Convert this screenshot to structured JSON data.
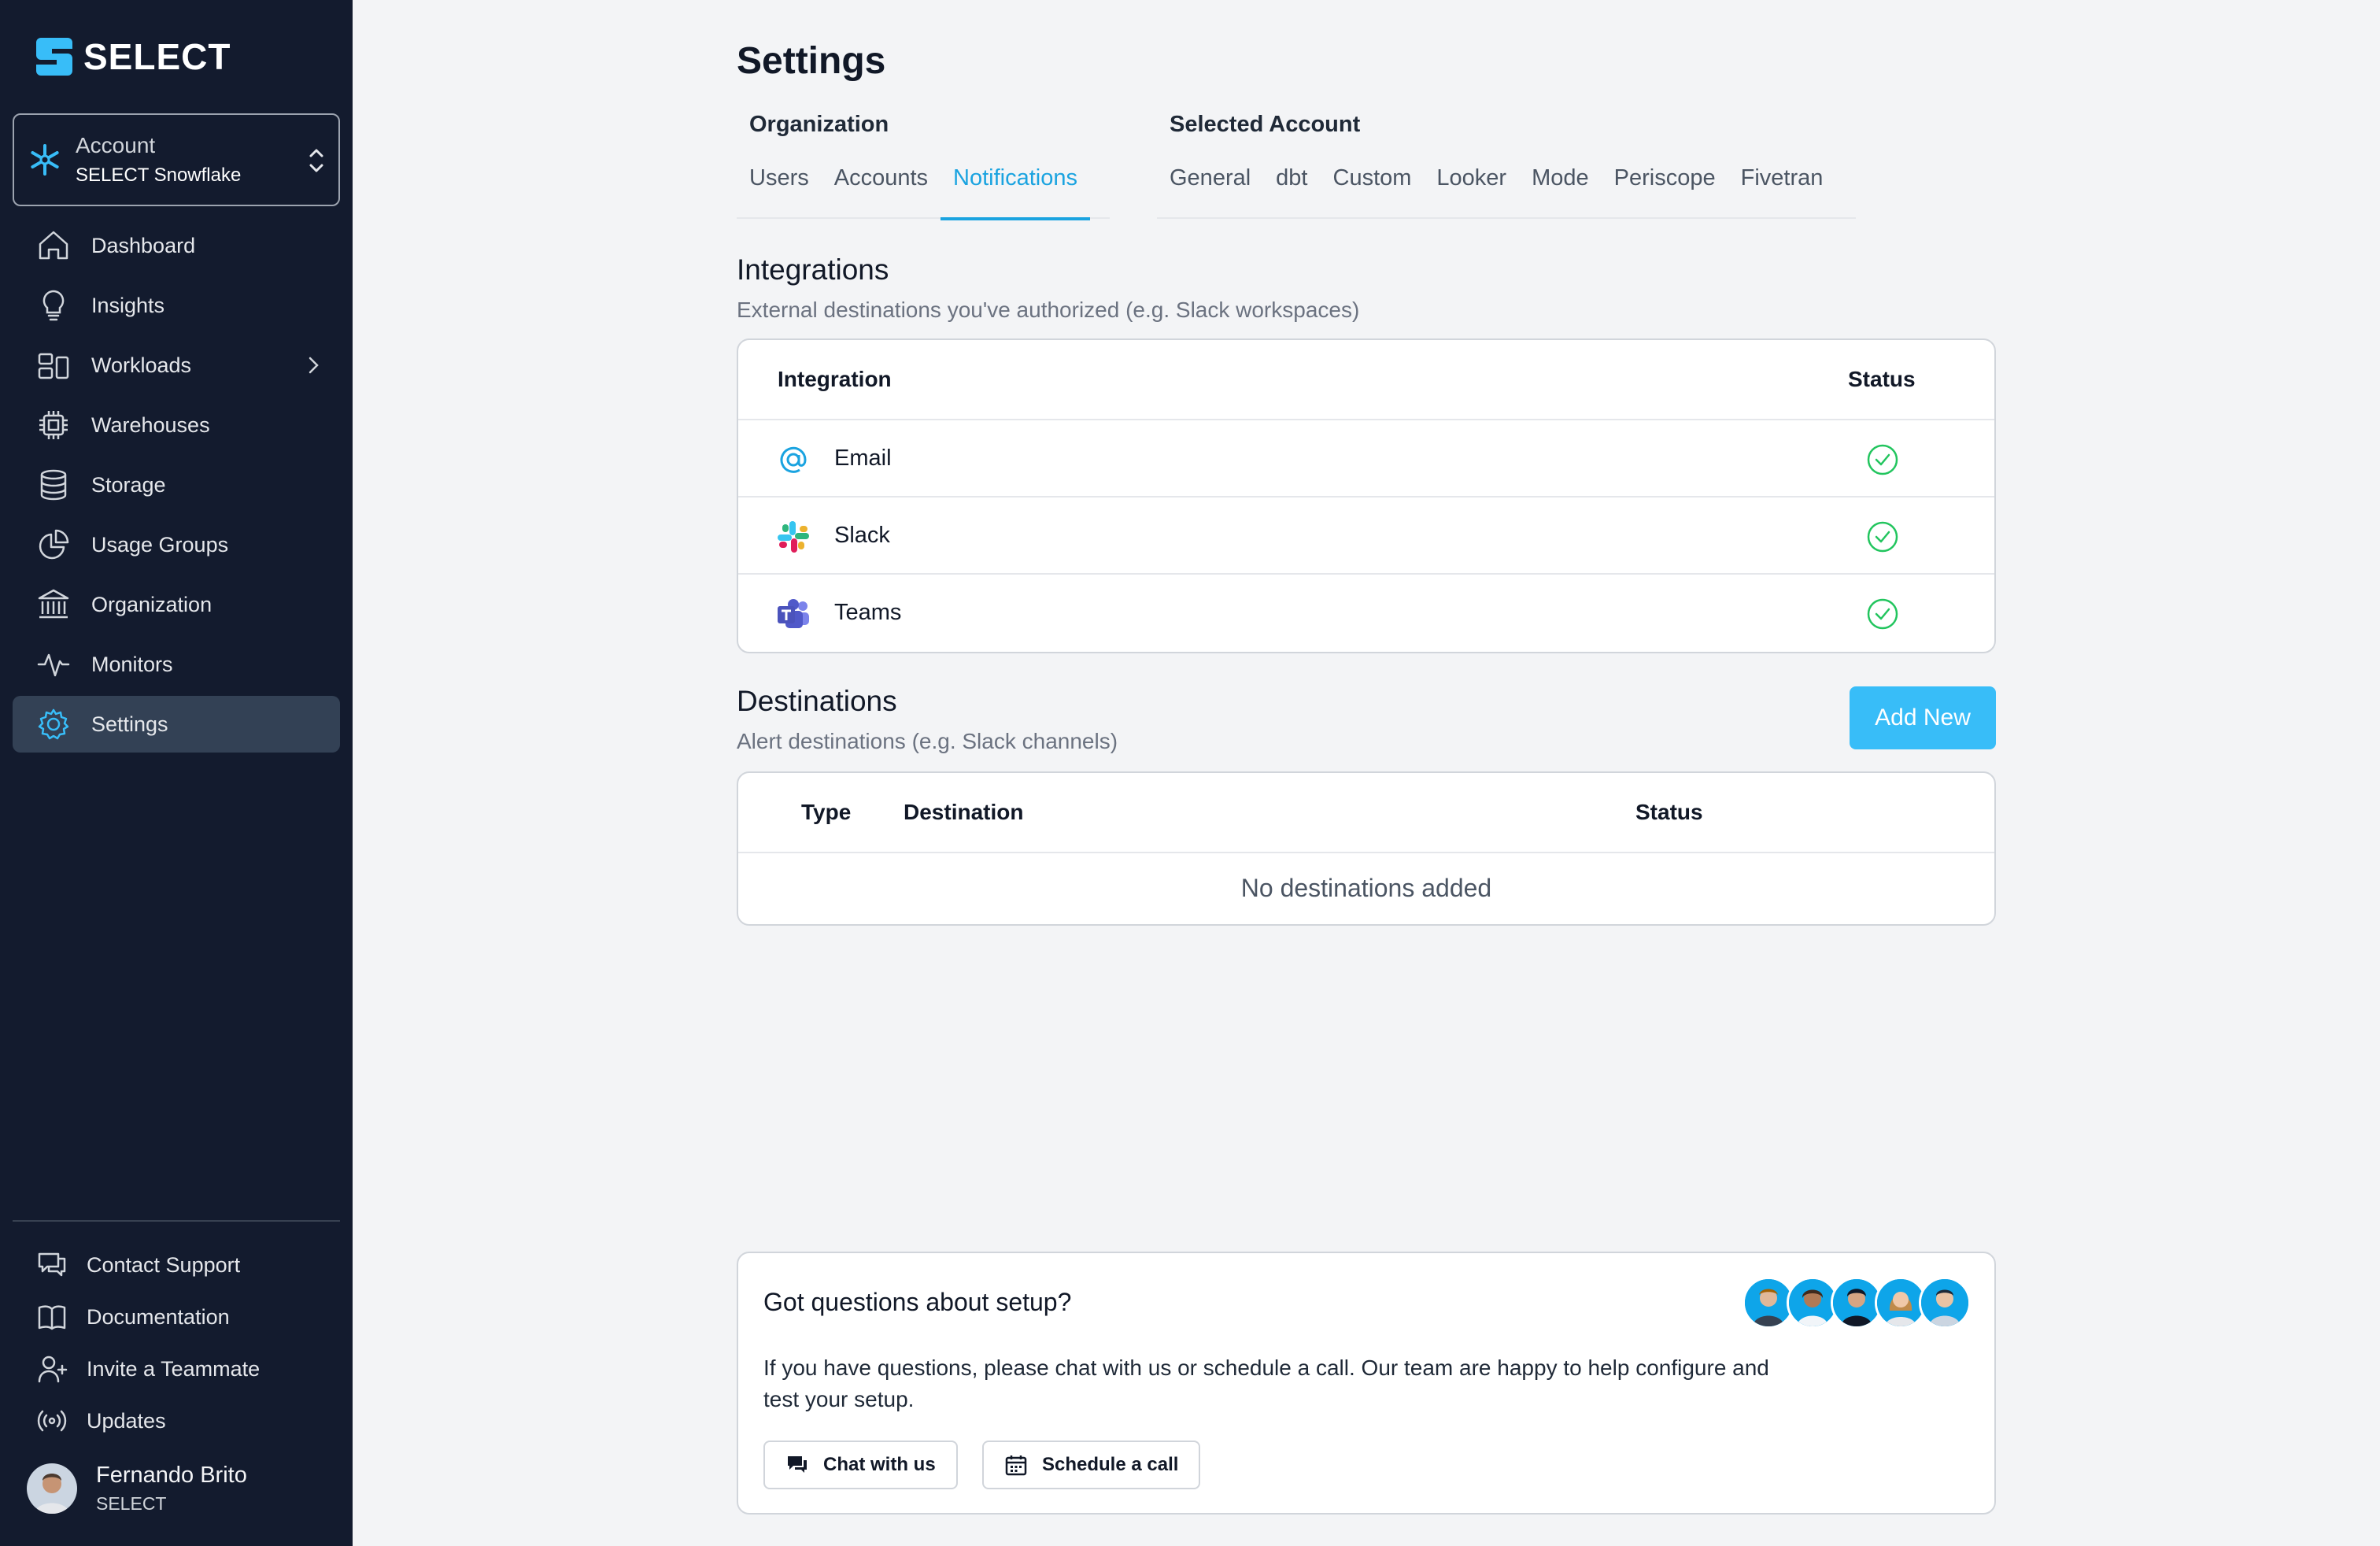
{
  "brand": {
    "name": "SELECT",
    "accent": "#1aa3e0",
    "sidebar_bg": "#131b2e"
  },
  "account": {
    "label": "Account",
    "value": "SELECT Snowflake"
  },
  "nav": [
    {
      "label": "Dashboard",
      "icon": "home-icon"
    },
    {
      "label": "Insights",
      "icon": "lightbulb-icon"
    },
    {
      "label": "Workloads",
      "icon": "workloads-icon",
      "has_submenu": true
    },
    {
      "label": "Warehouses",
      "icon": "chip-icon"
    },
    {
      "label": "Storage",
      "icon": "database-icon"
    },
    {
      "label": "Usage Groups",
      "icon": "pie-chart-icon"
    },
    {
      "label": "Organization",
      "icon": "bank-icon"
    },
    {
      "label": "Monitors",
      "icon": "pulse-icon"
    },
    {
      "label": "Settings",
      "icon": "gear-icon",
      "active": true
    }
  ],
  "footer_nav": [
    {
      "label": "Contact Support",
      "icon": "chat-bubble-icon"
    },
    {
      "label": "Documentation",
      "icon": "book-icon"
    },
    {
      "label": "Invite a Teammate",
      "icon": "user-plus-icon"
    },
    {
      "label": "Updates",
      "icon": "broadcast-icon"
    }
  ],
  "user": {
    "name": "Fernando Brito",
    "org": "SELECT"
  },
  "page": {
    "title": "Settings"
  },
  "tabs": {
    "organization": {
      "label": "Organization",
      "items": [
        "Users",
        "Accounts",
        "Notifications"
      ],
      "active": "Notifications"
    },
    "selected_account": {
      "label": "Selected Account",
      "items": [
        "General",
        "dbt",
        "Custom",
        "Looker",
        "Mode",
        "Periscope",
        "Fivetran"
      ]
    }
  },
  "integrations": {
    "title": "Integrations",
    "subtitle": "External destinations you've authorized (e.g. Slack workspaces)",
    "col_integration": "Integration",
    "col_status": "Status",
    "rows": [
      {
        "name": "Email",
        "icon": "at-sign-icon",
        "status": "connected"
      },
      {
        "name": "Slack",
        "icon": "slack-icon",
        "status": "connected"
      },
      {
        "name": "Teams",
        "icon": "teams-icon",
        "status": "connected"
      }
    ],
    "status_color": "#22c55e"
  },
  "destinations": {
    "title": "Destinations",
    "subtitle": "Alert destinations (e.g. Slack channels)",
    "add_label": "Add New",
    "col_type": "Type",
    "col_destination": "Destination",
    "col_status": "Status",
    "empty": "No destinations added"
  },
  "help": {
    "title": "Got questions about setup?",
    "body": "If you have questions, please chat with us or schedule a call. Our team are happy to help configure and test your setup.",
    "chat_label": "Chat with us",
    "schedule_label": "Schedule a call"
  }
}
